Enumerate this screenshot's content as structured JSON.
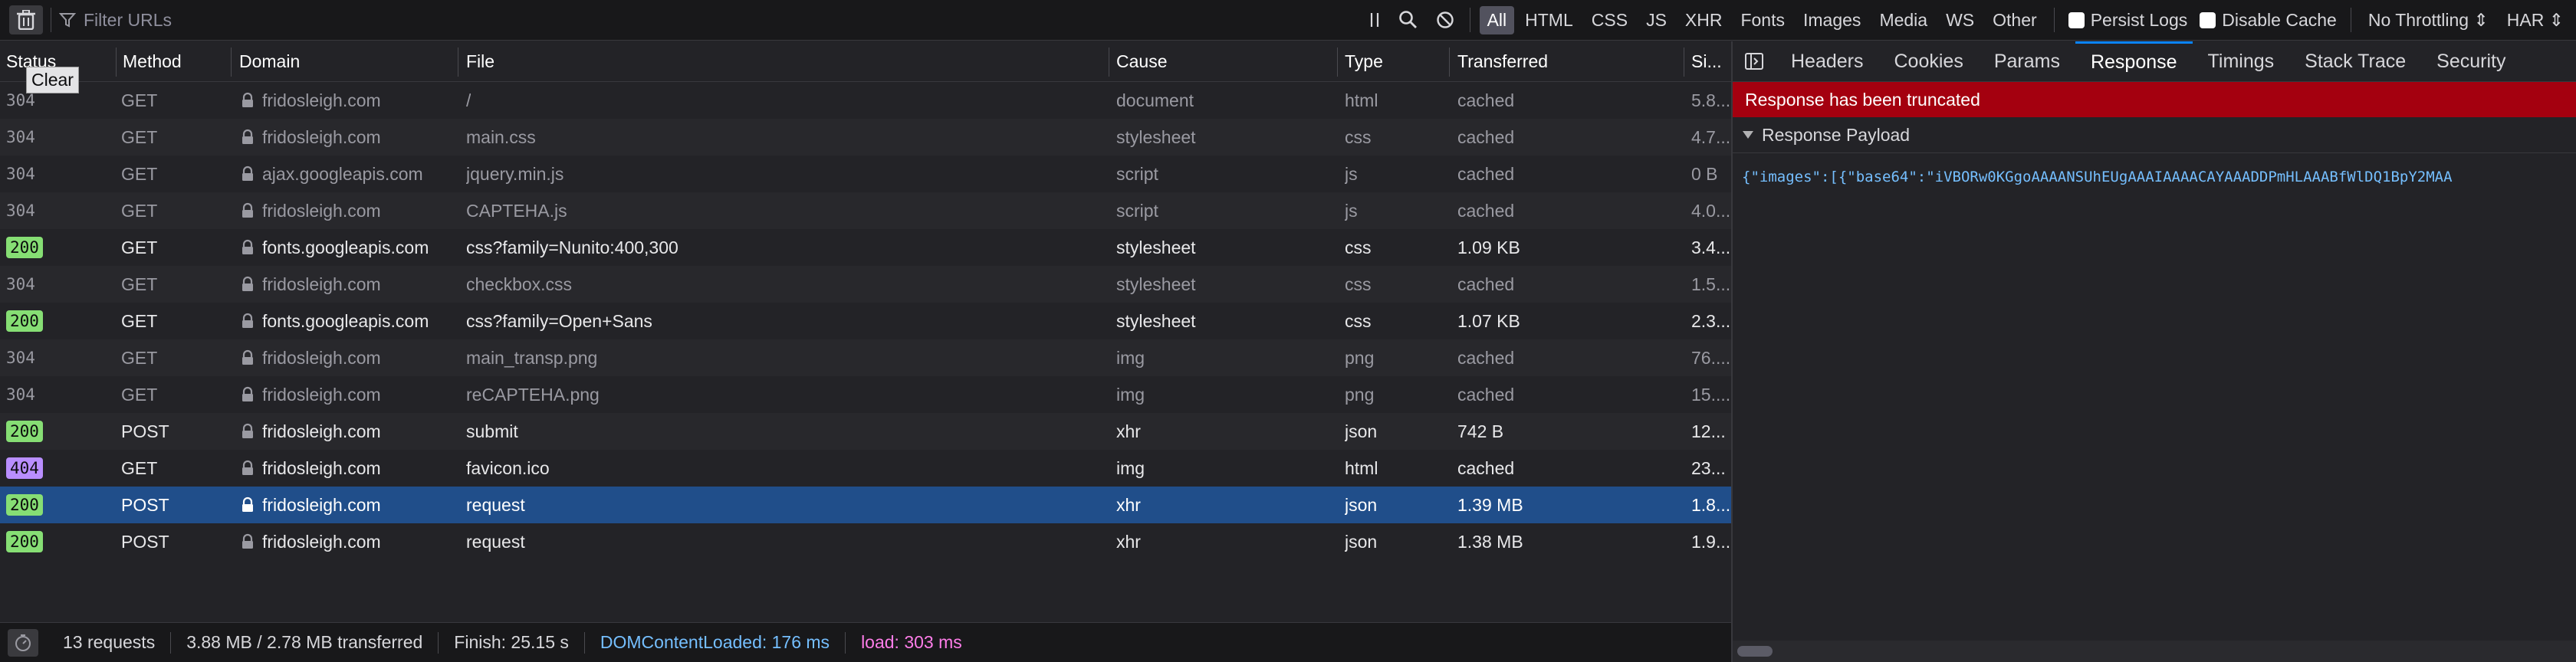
{
  "toolbar": {
    "filter_placeholder": "Filter URLs",
    "clear_tooltip": "Clear",
    "type_filters": [
      "All",
      "HTML",
      "CSS",
      "JS",
      "XHR",
      "Fonts",
      "Images",
      "Media",
      "WS",
      "Other"
    ],
    "active_filter": "All",
    "persist_logs": "Persist Logs",
    "disable_cache": "Disable Cache",
    "throttling": "No Throttling ⇕",
    "har": "HAR ⇕"
  },
  "columns": [
    "Status",
    "Method",
    "Domain",
    "File",
    "Cause",
    "Type",
    "Transferred",
    "Si..."
  ],
  "requests": [
    {
      "status": "304",
      "method": "GET",
      "domain": "fridosleigh.com",
      "file": "/",
      "cause": "document",
      "type": "html",
      "transferred": "cached",
      "size": "5.8..."
    },
    {
      "status": "304",
      "method": "GET",
      "domain": "fridosleigh.com",
      "file": "main.css",
      "cause": "stylesheet",
      "type": "css",
      "transferred": "cached",
      "size": "4.7..."
    },
    {
      "status": "304",
      "method": "GET",
      "domain": "ajax.googleapis.com",
      "file": "jquery.min.js",
      "cause": "script",
      "type": "js",
      "transferred": "cached",
      "size": "0 B"
    },
    {
      "status": "304",
      "method": "GET",
      "domain": "fridosleigh.com",
      "file": "CAPTEHA.js",
      "cause": "script",
      "type": "js",
      "transferred": "cached",
      "size": "4.0..."
    },
    {
      "status": "200",
      "method": "GET",
      "domain": "fonts.googleapis.com",
      "file": "css?family=Nunito:400,300",
      "cause": "stylesheet",
      "type": "css",
      "transferred": "1.09 KB",
      "size": "3.4..."
    },
    {
      "status": "304",
      "method": "GET",
      "domain": "fridosleigh.com",
      "file": "checkbox.css",
      "cause": "stylesheet",
      "type": "css",
      "transferred": "cached",
      "size": "1.5..."
    },
    {
      "status": "200",
      "method": "GET",
      "domain": "fonts.googleapis.com",
      "file": "css?family=Open+Sans",
      "cause": "stylesheet",
      "type": "css",
      "transferred": "1.07 KB",
      "size": "2.3..."
    },
    {
      "status": "304",
      "method": "GET",
      "domain": "fridosleigh.com",
      "file": "main_transp.png",
      "cause": "img",
      "type": "png",
      "transferred": "cached",
      "size": "76...."
    },
    {
      "status": "304",
      "method": "GET",
      "domain": "fridosleigh.com",
      "file": "reCAPTEHA.png",
      "cause": "img",
      "type": "png",
      "transferred": "cached",
      "size": "15...."
    },
    {
      "status": "200",
      "method": "POST",
      "domain": "fridosleigh.com",
      "file": "submit",
      "cause": "xhr",
      "type": "json",
      "transferred": "742 B",
      "size": "12..."
    },
    {
      "status": "404",
      "method": "GET",
      "domain": "fridosleigh.com",
      "file": "favicon.ico",
      "cause": "img",
      "type": "html",
      "transferred": "cached",
      "size": "23..."
    },
    {
      "status": "200",
      "method": "POST",
      "domain": "fridosleigh.com",
      "file": "request",
      "cause": "xhr",
      "type": "json",
      "transferred": "1.39 MB",
      "size": "1.8..."
    },
    {
      "status": "200",
      "method": "POST",
      "domain": "fridosleigh.com",
      "file": "request",
      "cause": "xhr",
      "type": "json",
      "transferred": "1.38 MB",
      "size": "1.9..."
    }
  ],
  "selected_row": 11,
  "statusbar": {
    "requests": "13 requests",
    "transferred": "3.88 MB / 2.78 MB transferred",
    "finish": "Finish: 25.15 s",
    "dom": "DOMContentLoaded: 176 ms",
    "load": "load: 303 ms"
  },
  "panel": {
    "tabs": [
      "Headers",
      "Cookies",
      "Params",
      "Response",
      "Timings",
      "Stack Trace",
      "Security"
    ],
    "active_tab": "Response",
    "banner": "Response has been truncated",
    "payload_title": "Response Payload",
    "payload_text": "{\"images\":[{\"base64\":\"iVBORw0KGgoAAAANSUhEUgAAAIAAAACAYAAADDPmHLAAABfWlDQ1BpY2MAA"
  },
  "colors": {
    "accent": "#0a84ff",
    "selected_row": "#204e8a",
    "status_200": "#86de74",
    "status_404": "#b98eff",
    "banner": "#a4000f",
    "dom_text": "#75bfff",
    "load_text": "#ff7de9"
  }
}
